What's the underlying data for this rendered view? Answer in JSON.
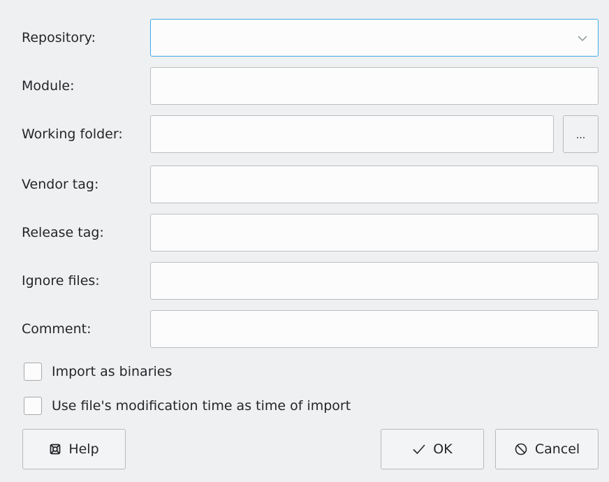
{
  "form": {
    "repository": {
      "label": "Repository:",
      "value": "",
      "icon": "chevron-down-icon"
    },
    "module": {
      "label": "Module:",
      "value": ""
    },
    "working_folder": {
      "label": "Working folder:",
      "value": "",
      "browse_label": "..."
    },
    "vendor_tag": {
      "label": "Vendor tag:",
      "value": ""
    },
    "release_tag": {
      "label": "Release tag:",
      "value": ""
    },
    "ignore_files": {
      "label": "Ignore files:",
      "value": ""
    },
    "comment": {
      "label": "Comment:",
      "value": ""
    }
  },
  "options": {
    "import_binaries": {
      "label": "Import as binaries",
      "checked": false
    },
    "use_mod_time": {
      "label": "Use file's modification time as time of import",
      "checked": false
    }
  },
  "buttons": {
    "help": {
      "label": "Help",
      "icon": "lifebuoy-icon"
    },
    "ok": {
      "label": "OK",
      "icon": "checkmark-icon"
    },
    "cancel": {
      "label": "Cancel",
      "icon": "cancel-icon"
    }
  },
  "colors": {
    "background": "#eff0f1",
    "focus_accent": "#3daee9",
    "text": "#232629"
  }
}
